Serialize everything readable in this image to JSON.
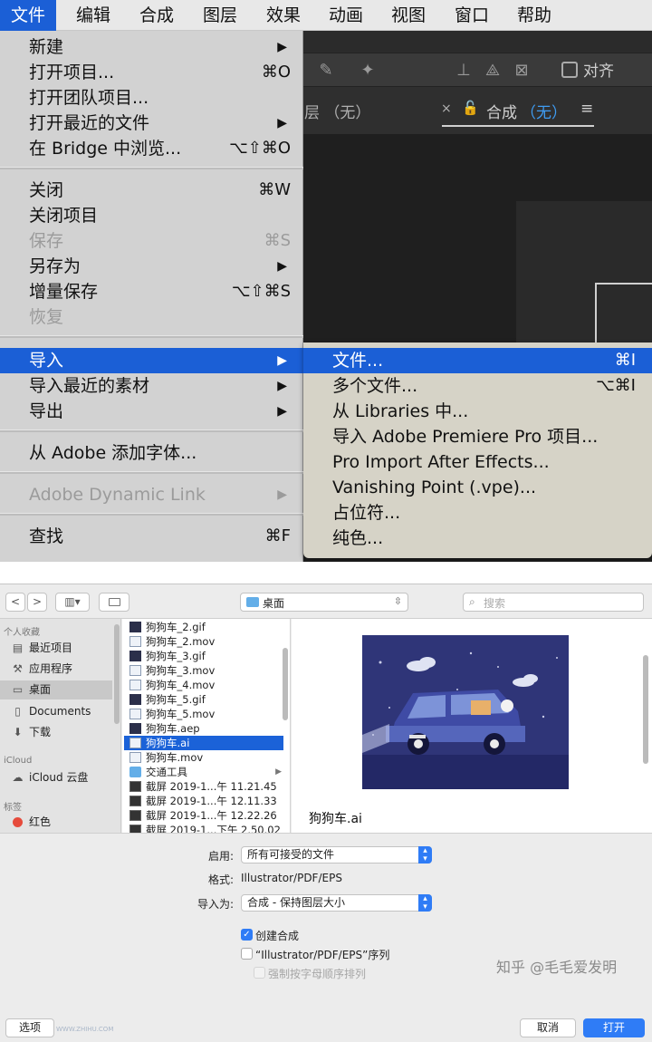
{
  "menubar": {
    "items": [
      "文件",
      "编辑",
      "合成",
      "图层",
      "效果",
      "动画",
      "视图",
      "窗口",
      "帮助"
    ]
  },
  "toolbar": {
    "snap_label": "对齐"
  },
  "panel": {
    "layer_tab": "层 （无）",
    "comp_tab_prefix": "合成",
    "comp_tab_value": "（无）",
    "close_glyph": "×",
    "menu_glyph": "≡"
  },
  "file_menu": {
    "items": [
      {
        "label": "新建",
        "shortcut": "",
        "submenu": true,
        "disabled": false
      },
      {
        "label": "打开项目...",
        "shortcut": "⌘O",
        "submenu": false,
        "disabled": false
      },
      {
        "label": "打开团队项目...",
        "shortcut": "",
        "submenu": false,
        "disabled": false
      },
      {
        "label": "打开最近的文件",
        "shortcut": "",
        "submenu": true,
        "disabled": false
      },
      {
        "label": "在 Bridge 中浏览...",
        "shortcut": "⌥⇧⌘O",
        "submenu": false,
        "disabled": false
      },
      {
        "label": "关闭",
        "shortcut": "⌘W",
        "submenu": false,
        "disabled": false
      },
      {
        "label": "关闭项目",
        "shortcut": "",
        "submenu": false,
        "disabled": false
      },
      {
        "label": "保存",
        "shortcut": "⌘S",
        "submenu": false,
        "disabled": true
      },
      {
        "label": "另存为",
        "shortcut": "",
        "submenu": true,
        "disabled": false
      },
      {
        "label": "增量保存",
        "shortcut": "⌥⇧⌘S",
        "submenu": false,
        "disabled": false
      },
      {
        "label": "恢复",
        "shortcut": "",
        "submenu": false,
        "disabled": true
      },
      {
        "label": "导入",
        "shortcut": "",
        "submenu": true,
        "disabled": false,
        "highlighted": true
      },
      {
        "label": "导入最近的素材",
        "shortcut": "",
        "submenu": true,
        "disabled": false
      },
      {
        "label": "导出",
        "shortcut": "",
        "submenu": true,
        "disabled": false
      },
      {
        "label": "从 Adobe 添加字体...",
        "shortcut": "",
        "submenu": false,
        "disabled": false
      },
      {
        "label": "Adobe Dynamic Link",
        "shortcut": "",
        "submenu": true,
        "disabled": true
      },
      {
        "label": "查找",
        "shortcut": "⌘F",
        "submenu": false,
        "disabled": false
      }
    ],
    "arrow_glyph": "▶"
  },
  "import_submenu": {
    "items": [
      {
        "label": "文件...",
        "shortcut": "⌘I",
        "highlighted": true
      },
      {
        "label": "多个文件...",
        "shortcut": "⌥⌘I"
      },
      {
        "label": "从 Libraries 中...",
        "shortcut": ""
      },
      {
        "label": "导入 Adobe Premiere Pro 项目...",
        "shortcut": ""
      },
      {
        "label": "Pro Import After Effects...",
        "shortcut": ""
      },
      {
        "label": "Vanishing Point (.vpe)...",
        "shortcut": ""
      },
      {
        "label": "占位符...",
        "shortcut": ""
      },
      {
        "label": "纯色...",
        "shortcut": ""
      }
    ]
  },
  "dialog": {
    "location": "桌面",
    "search_placeholder": "搜索",
    "nav_back": "<",
    "nav_forward": ">",
    "view_mode": "▥▾",
    "sidebar": {
      "favorites_header": "个人收藏",
      "favorites": [
        {
          "label": "最近项目",
          "icon": "recents-icon"
        },
        {
          "label": "应用程序",
          "icon": "applications-icon"
        },
        {
          "label": "桌面",
          "icon": "desktop-icon",
          "selected": true
        },
        {
          "label": "Documents",
          "icon": "documents-icon"
        },
        {
          "label": "下载",
          "icon": "downloads-icon"
        }
      ],
      "icloud_header": "iCloud",
      "icloud": [
        {
          "label": "iCloud 云盘",
          "icon": "cloud-icon"
        }
      ],
      "tags_header": "标签",
      "tags": [
        {
          "label": "红色",
          "color": "#e64b3c"
        }
      ]
    },
    "files": [
      {
        "name": "狗狗车_2.gif",
        "kind": "dark"
      },
      {
        "name": "狗狗车_2.mov",
        "kind": "mov"
      },
      {
        "name": "狗狗车_3.gif",
        "kind": "dark"
      },
      {
        "name": "狗狗车_3.mov",
        "kind": "mov"
      },
      {
        "name": "狗狗车_4.mov",
        "kind": "mov"
      },
      {
        "name": "狗狗车_5.gif",
        "kind": "dark"
      },
      {
        "name": "狗狗车_5.mov",
        "kind": "mov"
      },
      {
        "name": "狗狗车.aep",
        "kind": "dark"
      },
      {
        "name": "狗狗车.ai",
        "kind": "ai",
        "selected": true
      },
      {
        "name": "狗狗车.mov",
        "kind": "mov"
      },
      {
        "name": "交通工具",
        "kind": "folder",
        "folder": true
      },
      {
        "name": "截屏 2019-1...午 11.21.45",
        "kind": "shot"
      },
      {
        "name": "截屏 2019-1...午 12.11.33",
        "kind": "shot"
      },
      {
        "name": "截屏 2019-1...午 12.22.26",
        "kind": "shot"
      },
      {
        "name": "截屏 2019-1...下午 2.50.02",
        "kind": "shot"
      }
    ],
    "preview_filename": "狗狗车.ai",
    "enable_label": "启用:",
    "enable_value": "所有可接受的文件",
    "format_label": "格式:",
    "format_value": "Illustrator/PDF/EPS",
    "import_as_label": "导入为:",
    "import_as_value": "合成 - 保持图层大小",
    "create_comp_label": "创建合成",
    "create_comp_checked": true,
    "sequence_label": "“Illustrator/PDF/EPS”序列",
    "sequence_checked": false,
    "alpha_order_label": "强制按字母顺序排列",
    "alpha_order_disabled": true,
    "options_button": "选项",
    "cancel_button": "取消",
    "open_button": "打开",
    "watermark": "知乎 @毛毛爱发明",
    "watermark_small": "WWW.ZHIHU.COM"
  },
  "colors": {
    "menu_highlight": "#1b5fd6",
    "accent_blue": "#2f7cf6",
    "illustration_bg": "#2f3578"
  }
}
